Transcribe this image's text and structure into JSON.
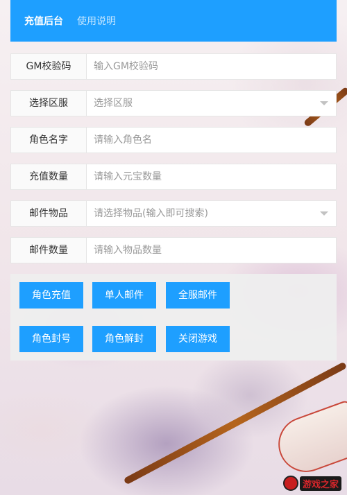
{
  "nav": {
    "items": [
      {
        "label": "充值后台",
        "active": true
      },
      {
        "label": "使用说明",
        "active": false
      }
    ]
  },
  "form": {
    "gm_code": {
      "label": "GM校验码",
      "placeholder": "输入GM校验码",
      "value": ""
    },
    "server": {
      "label": "选择区服",
      "placeholder": "选择区服"
    },
    "role_name": {
      "label": "角色名字",
      "placeholder": "请输入角色名",
      "value": ""
    },
    "recharge_amount": {
      "label": "充值数量",
      "placeholder": "请输入元宝数量",
      "value": ""
    },
    "mail_item": {
      "label": "邮件物品",
      "placeholder": "请选择物品(输入即可搜索)"
    },
    "mail_quantity": {
      "label": "邮件数量",
      "placeholder": "请输入物品数量",
      "value": ""
    }
  },
  "buttons": {
    "role_recharge": "角色充值",
    "single_mail": "单人邮件",
    "all_server_mail": "全服邮件",
    "ban_role": "角色封号",
    "unban_role": "角色解封",
    "close_game": "关闭游戏"
  },
  "watermark": {
    "logo_text": "游戏之家"
  },
  "colors": {
    "primary": "#1e9fff",
    "label_bg": "#fafafa",
    "border": "#e6e6e6",
    "panel_bg": "#eeeeee"
  }
}
